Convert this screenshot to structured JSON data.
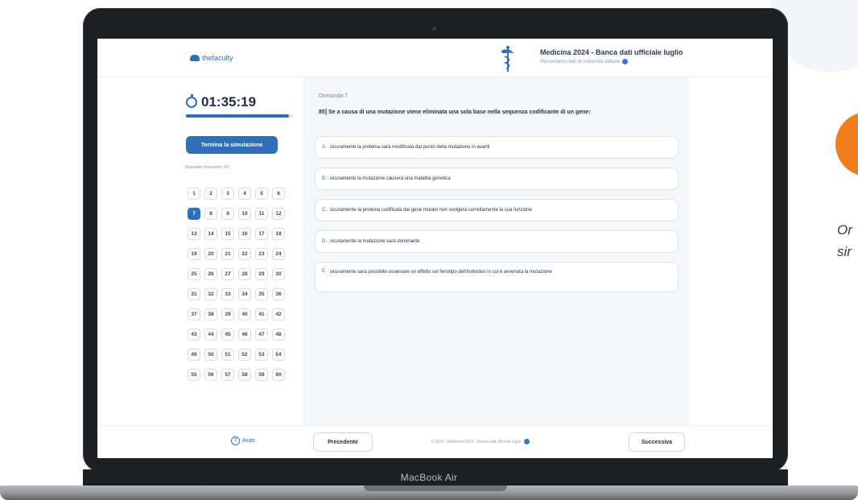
{
  "side": {
    "line1": "Or",
    "line2": "sir"
  },
  "laptop": {
    "brand": "MacBook Air"
  },
  "header": {
    "logo_text": "thefaculty",
    "title": "Medicina 2024 - Banca dati ufficiale luglio",
    "subtitle": "Percorsiamo dati di università italiane"
  },
  "timer": {
    "value": "01:35:19",
    "progress": 0.96
  },
  "end_button": "Termina la simulazione",
  "remaining": "Risposte mancanti: 60",
  "questions": [
    "1",
    "2",
    "3",
    "4",
    "5",
    "6",
    "7",
    "8",
    "9",
    "10",
    "11",
    "12",
    "13",
    "14",
    "15",
    "16",
    "17",
    "18",
    "19",
    "20",
    "21",
    "22",
    "23",
    "24",
    "25",
    "26",
    "27",
    "28",
    "29",
    "30",
    "31",
    "32",
    "33",
    "34",
    "35",
    "36",
    "37",
    "38",
    "39",
    "40",
    "41",
    "42",
    "43",
    "44",
    "45",
    "46",
    "47",
    "48",
    "49",
    "50",
    "51",
    "52",
    "53",
    "54",
    "55",
    "56",
    "57",
    "58",
    "59",
    "60"
  ],
  "active_question": "7",
  "main": {
    "domanda": "Domanda 7",
    "question": "85] Se a causa di una mutazione viene eliminata una sola base nella sequenza codificante di un gene:",
    "answers": [
      {
        "letter": "A.",
        "text": "sicuramente la proteina sarà modificata dal punto della mutazione in avanti"
      },
      {
        "letter": "B.",
        "text": "sicuramente la mutazione causerà una malattia genetica"
      },
      {
        "letter": "C.",
        "text": "sicuramente la proteina codificata dal gene mutato non svolgerà correttamente la sua funzione"
      },
      {
        "letter": "D.",
        "text": "sicuramente la mutazione sarà dominante"
      },
      {
        "letter": "E.",
        "text": "sicuramente sarà possibile osservare un effetto sul fenotipo dell'individuo in cui è avvenuta la mutazione"
      }
    ]
  },
  "footer": {
    "help": "Aiuto",
    "prev": "Precedente",
    "center": "© 2024 - Medicina 2024 - Banca dati ufficiale luglio",
    "next": "Successiva"
  },
  "colors": {
    "accent": "#2f6fb5",
    "orange": "#f07f1b"
  }
}
